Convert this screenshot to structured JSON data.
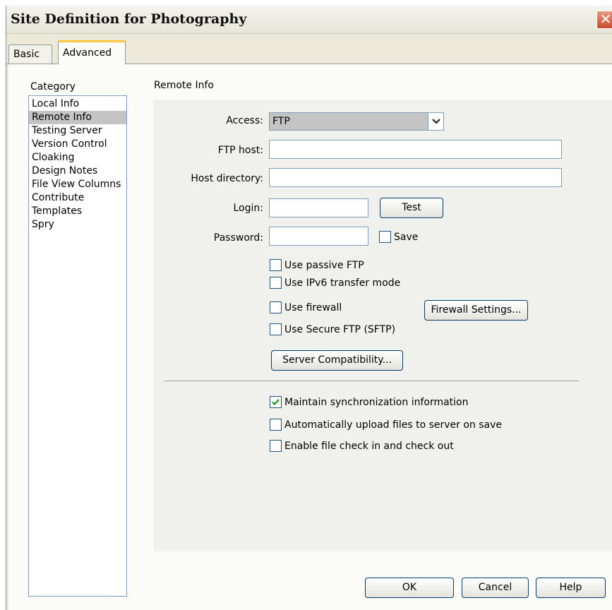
{
  "window": {
    "title": "Site Definition for Photography",
    "close_glyph": "✕"
  },
  "tabs": [
    {
      "label": "Basic"
    },
    {
      "label": "Advanced"
    }
  ],
  "category": {
    "label": "Category",
    "items": [
      {
        "label": "Local Info"
      },
      {
        "label": "Remote Info"
      },
      {
        "label": "Testing Server"
      },
      {
        "label": "Version Control"
      },
      {
        "label": "Cloaking"
      },
      {
        "label": "Design Notes"
      },
      {
        "label": "File View Columns"
      },
      {
        "label": "Contribute"
      },
      {
        "label": "Templates"
      },
      {
        "label": "Spry"
      }
    ],
    "selected": "Remote Info"
  },
  "section": {
    "title": "Remote Info"
  },
  "form": {
    "access_label": "Access:",
    "access_value": "FTP",
    "ftp_host_label": "FTP host:",
    "ftp_host_value": "",
    "host_dir_label": "Host directory:",
    "host_dir_value": "",
    "login_label": "Login:",
    "login_value": "",
    "test_button": "Test",
    "password_label": "Password:",
    "password_value": "",
    "save_label": "Save",
    "save_checked": false,
    "passive_ftp_label": "Use passive FTP",
    "ipv6_label": "Use IPv6 transfer mode",
    "firewall_label": "Use firewall",
    "firewall_settings_button": "Firewall Settings...",
    "sftp_label": "Use Secure FTP (SFTP)",
    "server_compat_button": "Server Compatibility...",
    "maintain_sync_label": "Maintain synchronization information",
    "maintain_sync_checked": true,
    "auto_upload_label": "Automatically upload files to server on save",
    "enable_checkin_label": "Enable file check in and check out"
  },
  "footer": {
    "ok_button": "OK",
    "cancel_button": "Cancel",
    "help_button": "Help"
  },
  "colors": {
    "selected_bg": "#c4c4c4",
    "check_green": "#21a121",
    "tab_highlight": "#ffc83c"
  }
}
